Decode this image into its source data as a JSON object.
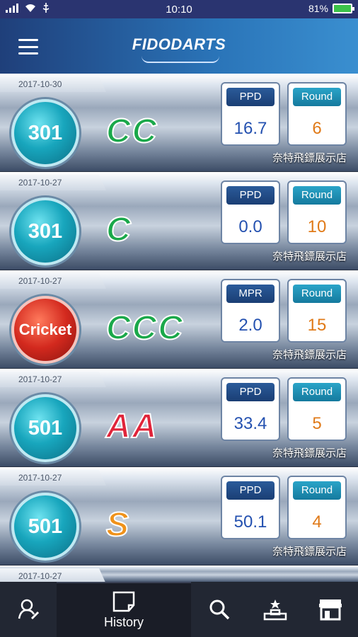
{
  "status_bar": {
    "time": "10:10",
    "battery_percent": "81%",
    "battery_level": 0.81
  },
  "header": {
    "brand": "FIDODARTS"
  },
  "games": [
    {
      "date": "2017-10-30",
      "game": "301",
      "ball_color": "teal",
      "award": "CC",
      "award_color": "green",
      "stat_label": "PPD",
      "stat_value": "16.7",
      "round_label": "Round",
      "round_value": "6",
      "shop": "奈特飛鏢展示店"
    },
    {
      "date": "2017-10-27",
      "game": "301",
      "ball_color": "teal",
      "award": "C",
      "award_color": "green",
      "stat_label": "PPD",
      "stat_value": "0.0",
      "round_label": "Round",
      "round_value": "10",
      "shop": "奈特飛鏢展示店"
    },
    {
      "date": "2017-10-27",
      "game": "Cricket",
      "ball_color": "red",
      "award": "CCC",
      "award_color": "green",
      "stat_label": "MPR",
      "stat_value": "2.0",
      "round_label": "Round",
      "round_value": "15",
      "shop": "奈特飛鏢展示店"
    },
    {
      "date": "2017-10-27",
      "game": "501",
      "ball_color": "teal",
      "award": "AA",
      "award_color": "red",
      "stat_label": "PPD",
      "stat_value": "33.4",
      "round_label": "Round",
      "round_value": "5",
      "shop": "奈特飛鏢展示店"
    },
    {
      "date": "2017-10-27",
      "game": "501",
      "ball_color": "teal",
      "award": "S",
      "award_color": "orange",
      "stat_label": "PPD",
      "stat_value": "50.1",
      "round_label": "Round",
      "round_value": "4",
      "shop": "奈特飛鏢展示店"
    },
    {
      "date": "2017-10-27"
    }
  ],
  "bottom_nav": {
    "items": [
      {
        "icon": "profile-icon"
      },
      {
        "icon": "history-icon",
        "label": "History"
      },
      {
        "icon": "search-icon"
      },
      {
        "icon": "ranking-icon"
      },
      {
        "icon": "shop-icon"
      }
    ]
  },
  "colors": {
    "status_bar": "#2a3470",
    "header_dark": "#1f3f7a",
    "header_light": "#3a8fd0",
    "nav_bg": "#222733",
    "ppd_blue": "#2451b0",
    "round_orange": "#e07a18"
  }
}
